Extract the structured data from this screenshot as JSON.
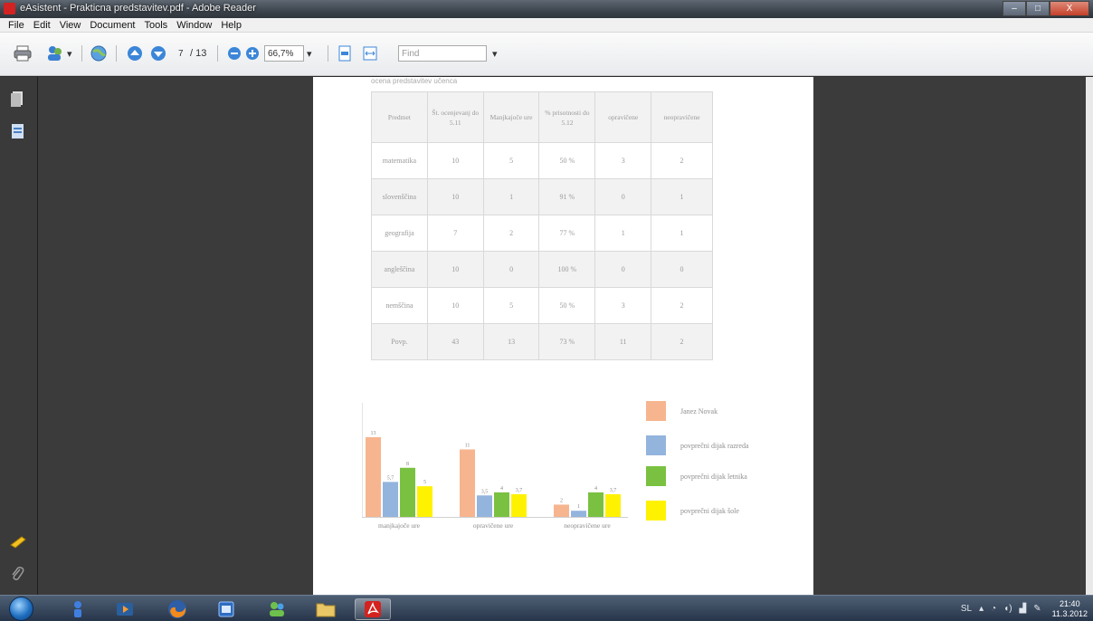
{
  "window": {
    "title": "eAsistent - Prakticna predstavitev.pdf - Adobe Reader",
    "buttons": {
      "minimize": "–",
      "maximize": "□",
      "close": "X"
    }
  },
  "menu": [
    "File",
    "Edit",
    "View",
    "Document",
    "Tools",
    "Window",
    "Help"
  ],
  "toolbar": {
    "current_page": "7",
    "total_pages": "/ 13",
    "zoom": "66,7%",
    "find_placeholder": "Find"
  },
  "document": {
    "cut_caption": "ocena predstavitev učenca",
    "table": {
      "headers": [
        "Predmet",
        "Št. ocenjevanj do 5.11",
        "Manjkajoče ure",
        "% prisotnosti do 5.12",
        "opravičene",
        "neopravičene"
      ],
      "rows": [
        [
          "matematika",
          "10",
          "5",
          "50 %",
          "3",
          "2"
        ],
        [
          "slovenščina",
          "10",
          "1",
          "91 %",
          "0",
          "1"
        ],
        [
          "geografija",
          "7",
          "2",
          "77 %",
          "1",
          "1"
        ],
        [
          "angleščina",
          "10",
          "0",
          "100 %",
          "0",
          "0"
        ],
        [
          "nemščina",
          "10",
          "5",
          "50 %",
          "3",
          "2"
        ],
        [
          "Povp.",
          "43",
          "13",
          "73 %",
          "11",
          "2"
        ]
      ]
    }
  },
  "chart_data": {
    "type": "bar",
    "categories": [
      "manjkajoče ure",
      "opravičene ure",
      "neopravičene ure"
    ],
    "series": [
      {
        "name": "Janez Novak",
        "color": "#f7b58f",
        "values": [
          13,
          11,
          2
        ]
      },
      {
        "name": "povprečni dijak razreda",
        "color": "#93b4dd",
        "values": [
          5.7,
          3.5,
          1
        ]
      },
      {
        "name": "povprečni dijak letnika",
        "color": "#7ac142",
        "values": [
          8,
          4,
          4
        ]
      },
      {
        "name": "povprečni dijak šole",
        "color": "#fff200",
        "values": [
          5,
          3.7,
          3.7
        ]
      }
    ],
    "value_labels": [
      [
        "13",
        "11",
        "2"
      ],
      [
        "5,7",
        "3,5",
        "1"
      ],
      [
        "8",
        "4",
        "4"
      ],
      [
        "5",
        "3,7",
        "3,7"
      ]
    ],
    "ylim": [
      0,
      18
    ],
    "legend_position": "right"
  },
  "taskbar": {
    "clock_time": "21:40",
    "clock_date": "11.3.2012",
    "tray_lang": "SL"
  }
}
